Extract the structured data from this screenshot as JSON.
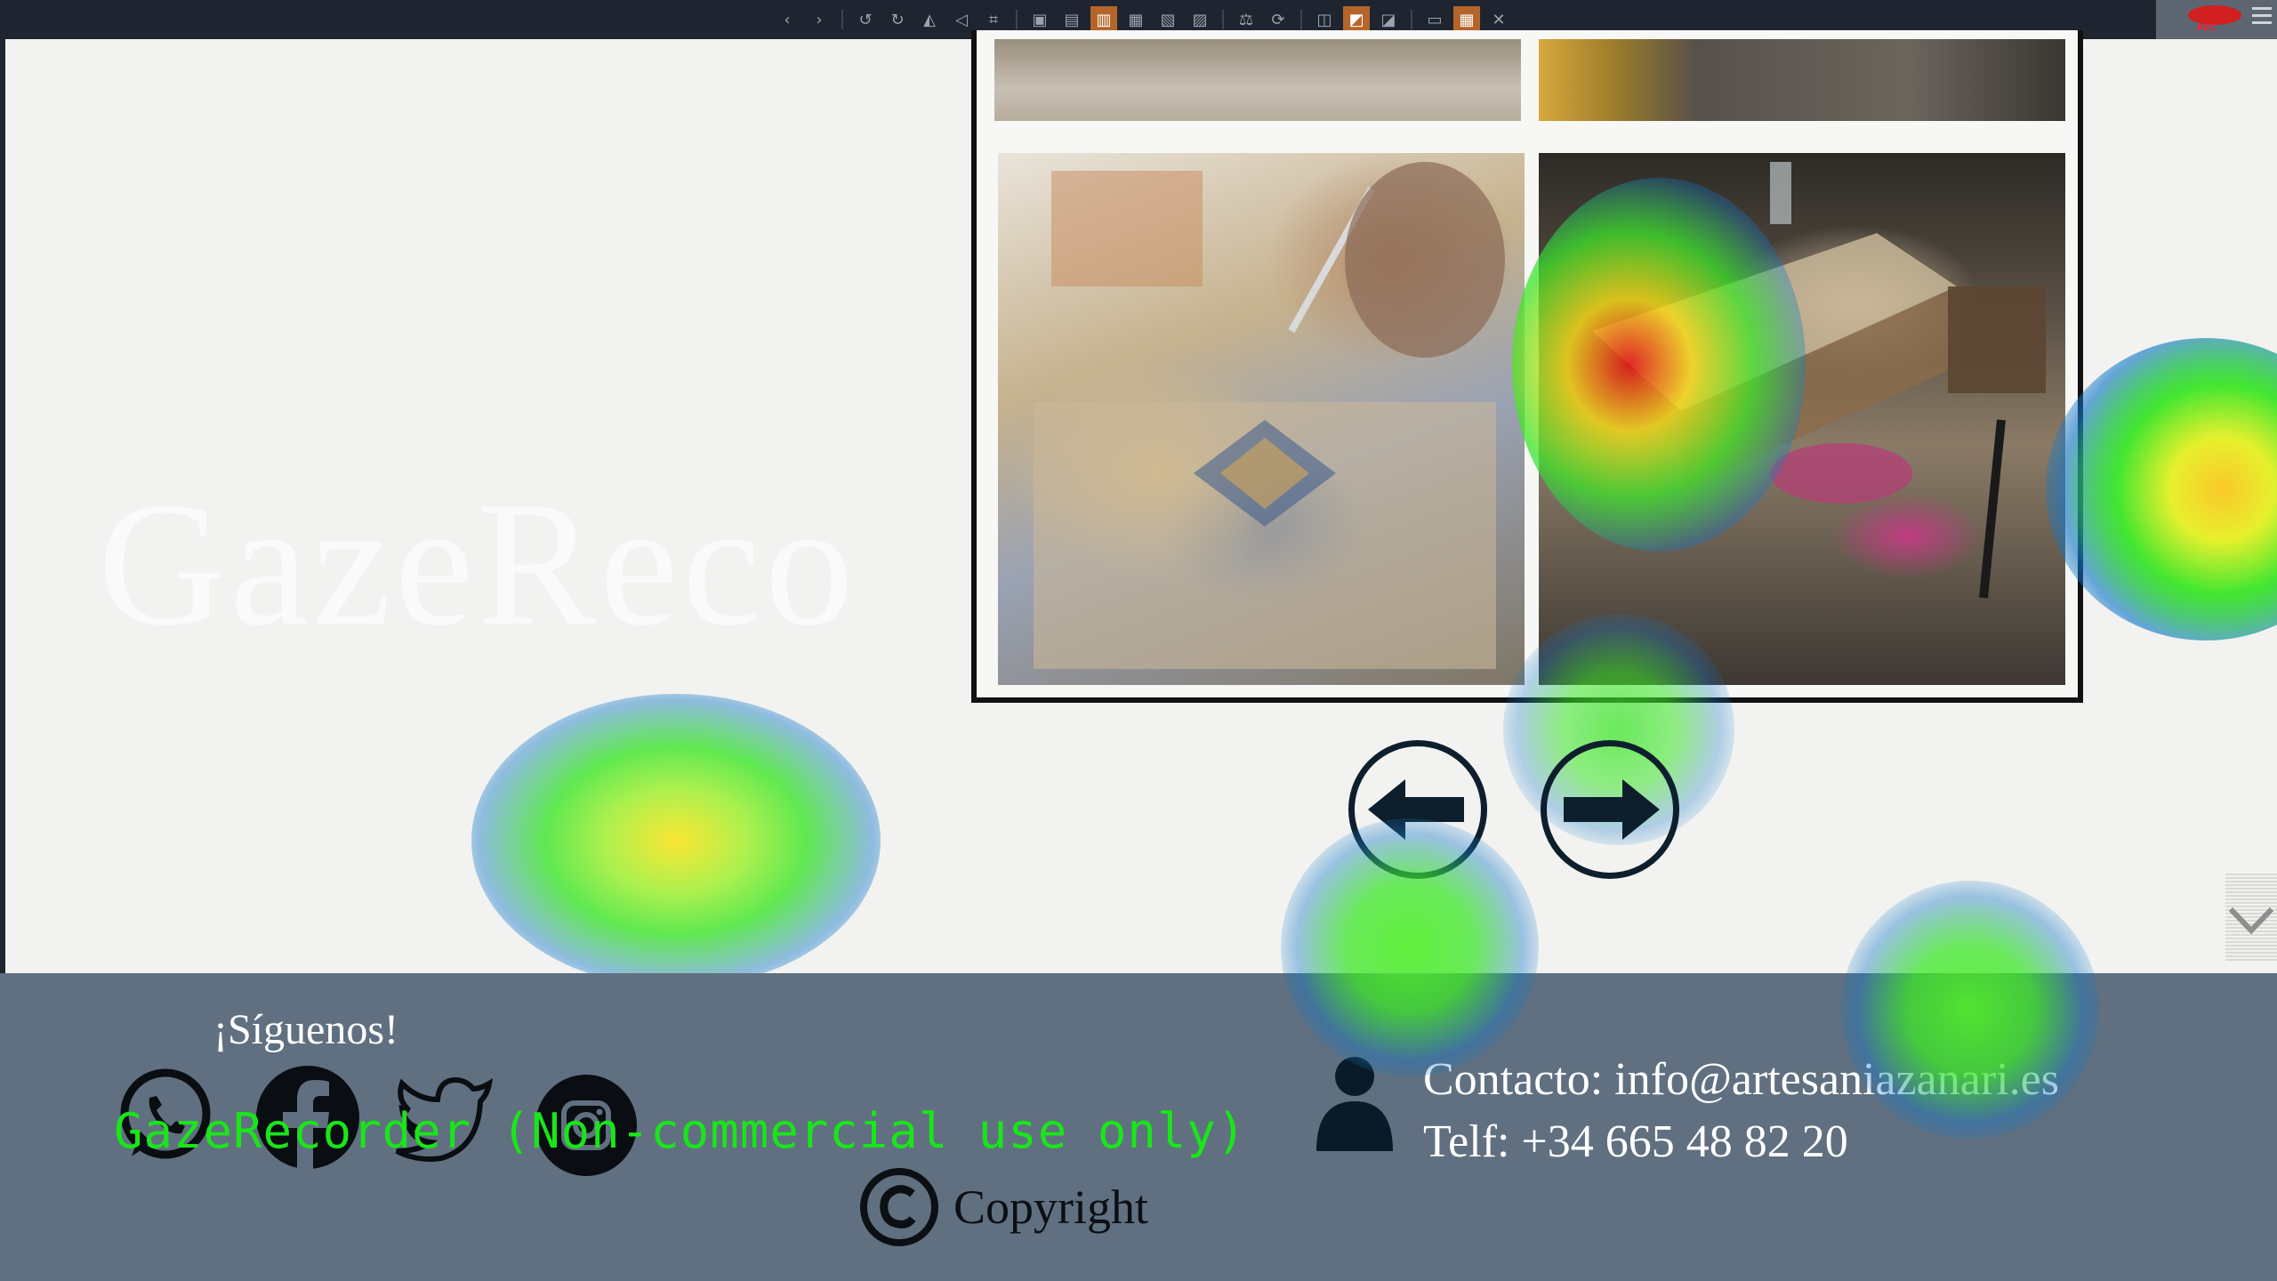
{
  "toolbar": {
    "recording_label": "REC",
    "buttons": [
      {
        "icon": "chevron-left-icon",
        "glyph": "‹"
      },
      {
        "icon": "chevron-right-icon",
        "glyph": "›"
      },
      {
        "icon": "undo-icon",
        "glyph": "↺"
      },
      {
        "icon": "redo-icon",
        "glyph": "↻"
      },
      {
        "icon": "flip-horizontal-icon",
        "glyph": "◭"
      },
      {
        "icon": "flip-vertical-icon",
        "glyph": "◁"
      },
      {
        "icon": "crop-icon",
        "glyph": "⌗"
      },
      {
        "icon": "frame-icon-1",
        "glyph": "▣"
      },
      {
        "icon": "frame-icon-2",
        "glyph": "▤"
      },
      {
        "icon": "frame-icon-3",
        "glyph": "▥"
      },
      {
        "icon": "frame-icon-4",
        "glyph": "▦"
      },
      {
        "icon": "frame-icon-5",
        "glyph": "▧"
      },
      {
        "icon": "frame-icon-6",
        "glyph": "▨"
      },
      {
        "icon": "scale-icon",
        "glyph": "⚖"
      },
      {
        "icon": "refresh-icon",
        "glyph": "⟳"
      },
      {
        "icon": "layout-icon-1",
        "glyph": "◫"
      },
      {
        "icon": "layout-icon-2",
        "glyph": "◩"
      },
      {
        "icon": "heatmap-icon",
        "glyph": "◪"
      },
      {
        "icon": "image-icon",
        "glyph": "▭"
      },
      {
        "icon": "grid-icon",
        "glyph": "▦"
      },
      {
        "icon": "trash-icon",
        "glyph": "🗑"
      }
    ]
  },
  "watermark": "GazeReco",
  "footer": {
    "follow_title": "¡Síguenos!",
    "overlay_notice": "GazeRecorder (Non-commercial use only)",
    "copyright": "Copyright",
    "contact_email": "Contacto: info@artesaniazanari.es",
    "contact_phone": "Telf: +34 665 48 82 20"
  },
  "colors": {
    "toolbar_bg": "#1e2530",
    "footer_bg": "#607080",
    "accent_active": "#b5652a",
    "overlay_text": "#19e619"
  }
}
